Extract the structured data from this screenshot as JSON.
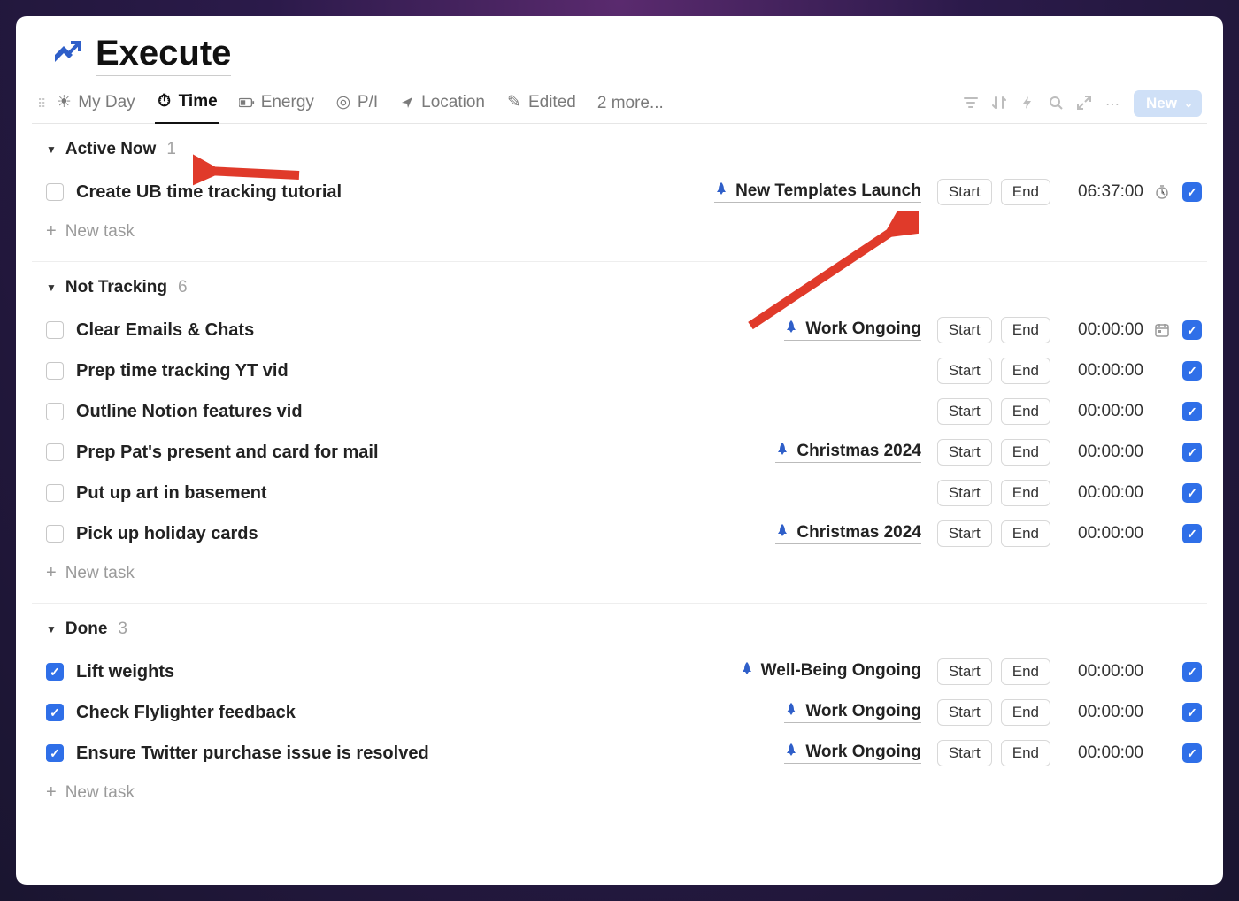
{
  "page": {
    "title": "Execute"
  },
  "tabs": {
    "items": [
      {
        "label": "My Day",
        "icon": "sun"
      },
      {
        "label": "Time",
        "icon": "stopwatch"
      },
      {
        "label": "Energy",
        "icon": "battery"
      },
      {
        "label": "P/I",
        "icon": "target"
      },
      {
        "label": "Location",
        "icon": "nav"
      },
      {
        "label": "Edited",
        "icon": "pen"
      }
    ],
    "active_index": 1,
    "more_label": "2 more..."
  },
  "toolbar": {
    "new_label": "New"
  },
  "groups": [
    {
      "name": "Active Now",
      "count": 1,
      "tasks": [
        {
          "title": "Create UB time tracking tutorial",
          "done": false,
          "tag": "New Templates Launch",
          "start": "Start",
          "end": "End",
          "time": "06:37:00",
          "end_icon": "stopwatch"
        }
      ]
    },
    {
      "name": "Not Tracking",
      "count": 6,
      "tasks": [
        {
          "title": "Clear Emails & Chats",
          "done": false,
          "tag": "Work Ongoing",
          "start": "Start",
          "end": "End",
          "time": "00:00:00",
          "end_icon": "calendar"
        },
        {
          "title": "Prep time tracking YT vid",
          "done": false,
          "tag": "",
          "start": "Start",
          "end": "End",
          "time": "00:00:00",
          "end_icon": ""
        },
        {
          "title": "Outline Notion features vid",
          "done": false,
          "tag": "",
          "start": "Start",
          "end": "End",
          "time": "00:00:00",
          "end_icon": ""
        },
        {
          "title": "Prep Pat's present and card for mail",
          "done": false,
          "tag": "Christmas 2024",
          "start": "Start",
          "end": "End",
          "time": "00:00:00",
          "end_icon": ""
        },
        {
          "title": "Put up art in basement",
          "done": false,
          "tag": "",
          "start": "Start",
          "end": "End",
          "time": "00:00:00",
          "end_icon": ""
        },
        {
          "title": "Pick up holiday cards",
          "done": false,
          "tag": "Christmas 2024",
          "start": "Start",
          "end": "End",
          "time": "00:00:00",
          "end_icon": ""
        }
      ]
    },
    {
      "name": "Done",
      "count": 3,
      "tasks": [
        {
          "title": "Lift weights",
          "done": true,
          "tag": "Well-Being Ongoing",
          "start": "Start",
          "end": "End",
          "time": "00:00:00",
          "end_icon": ""
        },
        {
          "title": "Check Flylighter feedback",
          "done": true,
          "tag": "Work Ongoing",
          "start": "Start",
          "end": "End",
          "time": "00:00:00",
          "end_icon": ""
        },
        {
          "title": "Ensure Twitter purchase issue is resolved",
          "done": true,
          "tag": "Work Ongoing",
          "start": "Start",
          "end": "End",
          "time": "00:00:00",
          "end_icon": ""
        }
      ]
    }
  ],
  "labels": {
    "new_task": "New task"
  }
}
